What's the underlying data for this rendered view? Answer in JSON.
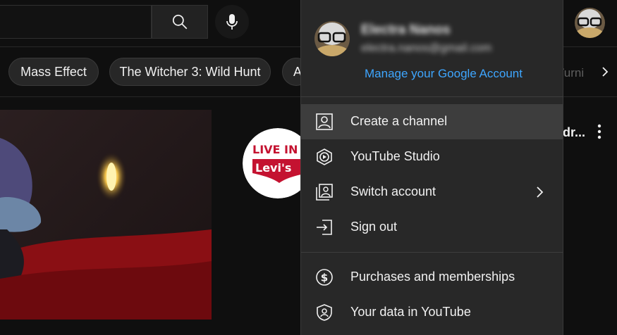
{
  "header": {
    "search_placeholder": "",
    "account_avatar": "account-avatar"
  },
  "chips": [
    {
      "label": "Mass Effect"
    },
    {
      "label": "The Witcher 3: Wild Hunt"
    },
    {
      "label": "A"
    },
    {
      "label": "Turni"
    }
  ],
  "feed": {
    "channel_logo_text_1": "LIVE IN",
    "channel_logo_text_2": "Levi's",
    "video_title_fragment": "dr..."
  },
  "account_menu": {
    "user_name": "Electra Nanos",
    "user_email": "electra.nanos@gmail.com",
    "manage_account_link": "Manage your Google Account",
    "sections": [
      [
        {
          "label": "Create a channel",
          "icon": "person-square-icon"
        },
        {
          "label": "YouTube Studio",
          "icon": "studio-hexagon-icon"
        },
        {
          "label": "Switch account",
          "icon": "switch-account-icon",
          "has_submenu": true
        },
        {
          "label": "Sign out",
          "icon": "sign-out-icon"
        }
      ],
      [
        {
          "label": "Purchases and memberships",
          "icon": "dollar-circle-icon"
        },
        {
          "label": "Your data in YouTube",
          "icon": "shield-person-icon"
        }
      ]
    ]
  },
  "colors": {
    "background": "#0f0f0f",
    "menu_background": "#282828",
    "link_blue": "#3ea6ff",
    "logo_red": "#c41230"
  }
}
